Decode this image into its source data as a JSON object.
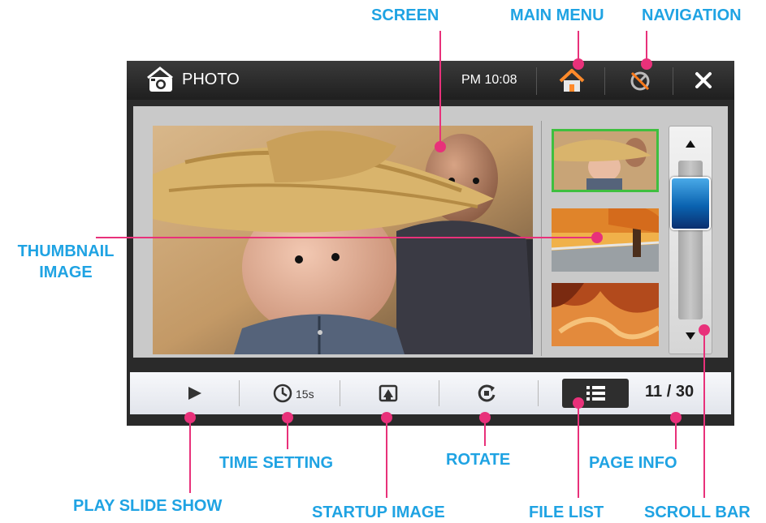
{
  "app": {
    "title": "PHOTO",
    "clock": "PM 10:08"
  },
  "toolbar": {
    "timer_value": "15s",
    "page_current": "11",
    "page_total": "30",
    "page_separator": "/"
  },
  "callouts": {
    "screen": "SCREEN",
    "main_menu": "MAIN MENU",
    "navigation": "NAVIGATION",
    "thumbnail_line1": "THUMBNAIL",
    "thumbnail_line2": "IMAGE",
    "time_setting": "TIME SETTING",
    "rotate": "ROTATE",
    "page_info": "PAGE INFO",
    "play_slide_show": "PLAY SLIDE SHOW",
    "startup_image": "STARTUP IMAGE",
    "file_list": "FILE LIST",
    "scroll_bar": "SCROLL BAR"
  },
  "icons": [
    "camera-icon",
    "home-icon",
    "navigation-off-icon",
    "close-icon",
    "play-icon",
    "clock-icon",
    "startup-image-icon",
    "rotate-icon",
    "list-icon",
    "arrow-up-icon",
    "arrow-down-icon"
  ],
  "colors": {
    "callout_text": "#1fa3e3",
    "leader_line": "#e8317a",
    "selected_thumb_border": "#3fbf3f",
    "scroll_thumb": "#0a63b0"
  }
}
